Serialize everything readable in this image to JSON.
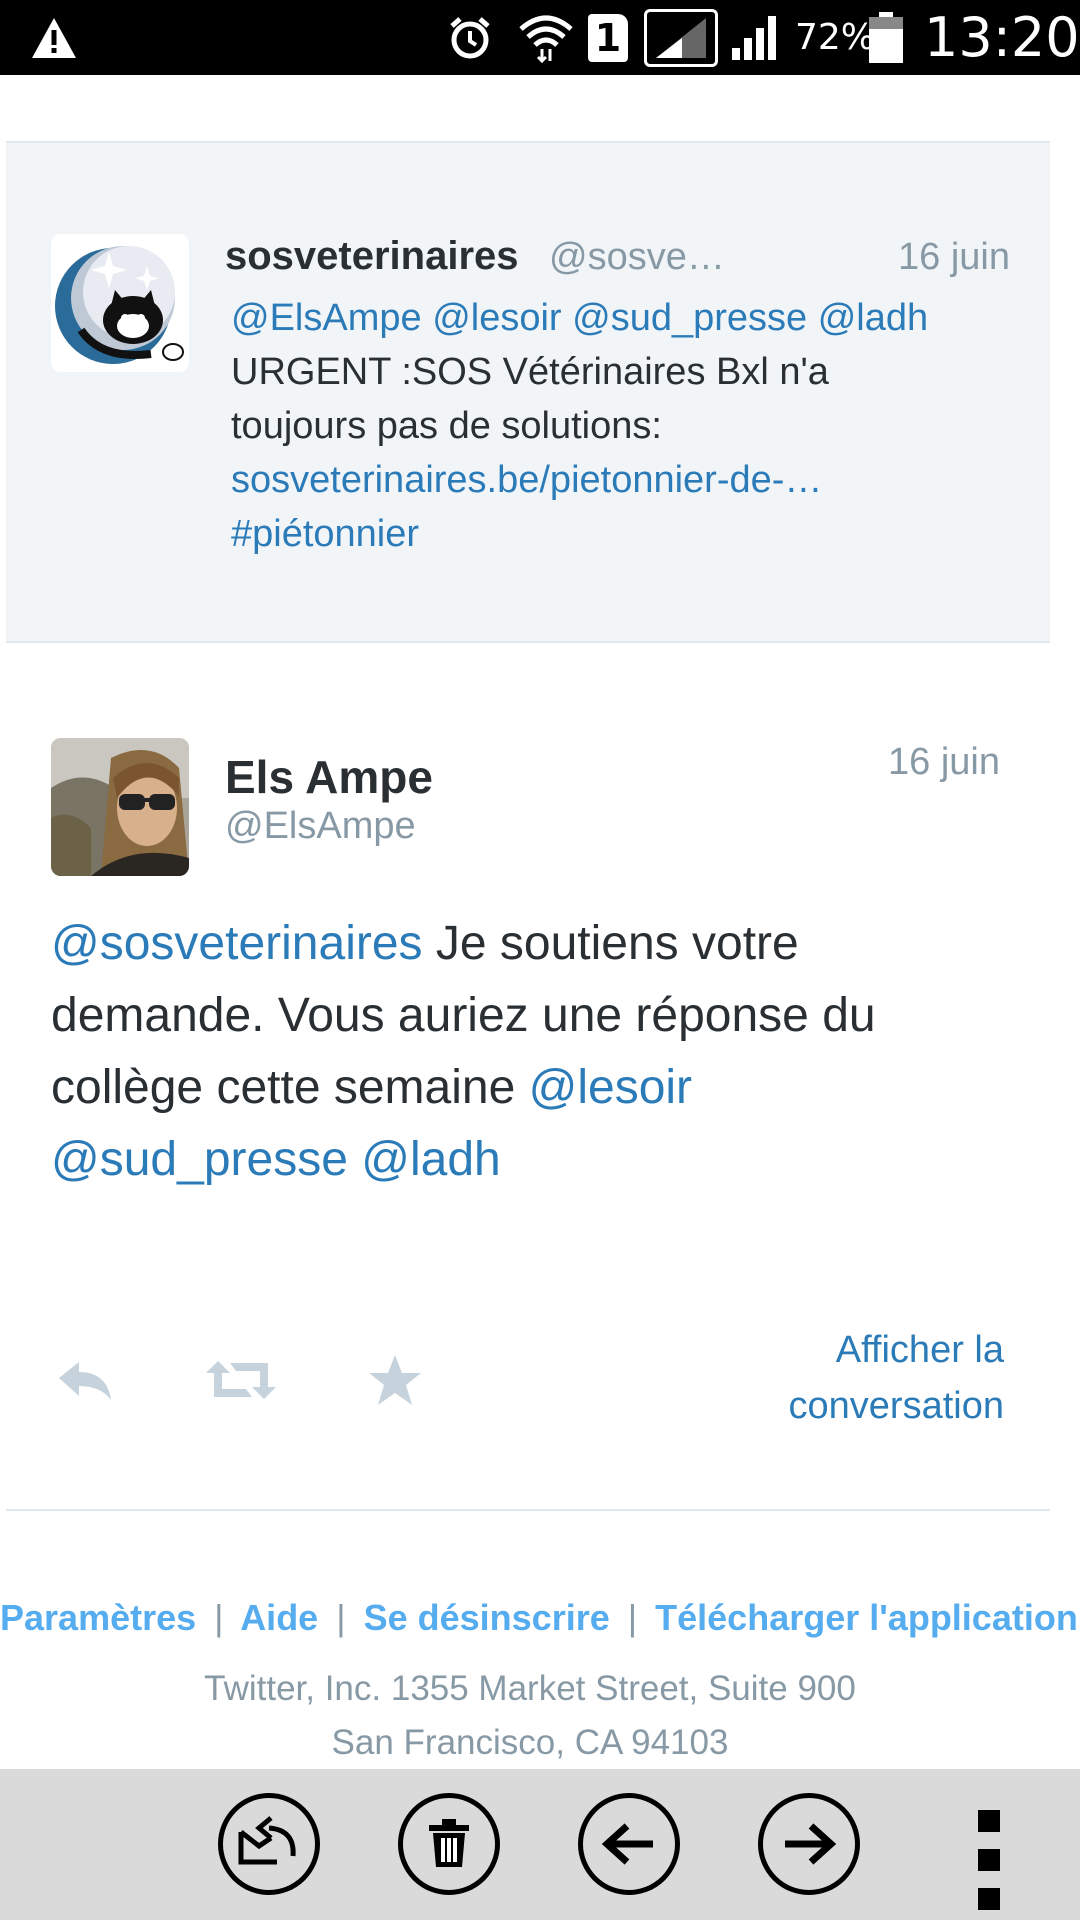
{
  "status_bar": {
    "battery": "72%",
    "time": "13:20",
    "sim_slot": "1",
    "icons": [
      "warning-icon",
      "alarm-icon",
      "wifi-icon",
      "sim-icon",
      "signal-icon",
      "signal-icon",
      "battery-icon"
    ]
  },
  "quoted_tweet": {
    "name": "sosveterinaires",
    "handle": "@sosve…",
    "date": "16 juin",
    "lines": [
      "@ElsAmpe @lesoir @sud_presse @ladh",
      "URGENT :SOS Vétérinaires Bxl n'a",
      "toujours pas de solutions:",
      "sosveterinaires.be/pietonnier-de-…",
      "#piétonnier"
    ]
  },
  "tweet": {
    "name": "Els Ampe",
    "handle": "@ElsAmpe",
    "date": "16 juin",
    "body": {
      "mention1": "@sosveterinaires",
      "text1": " Je soutiens votre",
      "text2": "demande. Vous auriez une réponse du",
      "text3": "collège cette semaine ",
      "mention2": "@lesoir",
      "mention3": "@sud_presse",
      "mention4": "@ladh"
    },
    "show_conversation_line1": "Afficher la",
    "show_conversation_line2": "conversation"
  },
  "footer": {
    "links": [
      "Paramètres",
      "Aide",
      "Se désinscrire",
      "Télécharger l'application"
    ],
    "separator": "|",
    "address_line1": "Twitter, Inc. 1355 Market Street, Suite 900",
    "address_line2": "San Francisco, CA 94103"
  },
  "bottom_bar": {
    "buttons": [
      "reply-mail-icon",
      "trash-icon",
      "arrow-left-icon",
      "arrow-right-icon",
      "more-vert-icon"
    ]
  },
  "colors": {
    "link": "#2b7bb9",
    "footer_link": "#55acee",
    "muted": "#8899a6",
    "quoted_bg": "#f2f5f8"
  }
}
